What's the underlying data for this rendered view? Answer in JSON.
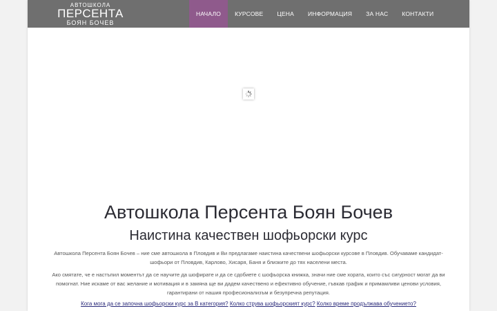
{
  "header": {
    "logo": {
      "line1": "АВТОШКОЛА",
      "line2": "ПЕРСЕНТА",
      "line3": "БОЯН БОЧЕВ"
    },
    "nav": [
      {
        "label": "НАЧАЛО",
        "active": true
      },
      {
        "label": "КУРСОВЕ",
        "active": false
      },
      {
        "label": "ЦЕНА",
        "active": false
      },
      {
        "label": "ИНФОРМАЦИЯ",
        "active": false
      },
      {
        "label": "ЗА НАС",
        "active": false
      },
      {
        "label": "КОНТАКТИ",
        "active": false
      }
    ]
  },
  "slider": {
    "loader_icon": "spinner-icon"
  },
  "main": {
    "title": "Автошкола Персента Боян Бочев",
    "subtitle": "Наистина качествен шофьорски курс",
    "paragraph1": "Автошкола Персента Боян Бочев – ние сме автошкола в Пловдив и Ви предлагаме наистина качествени шофьорски курсове в Пловдив. Обучаваме кандидат-шофьори от Пловдив, Карлово, Хисаря, Баня и близките до тях населени места.",
    "paragraph2": "Ако смятате, че е настъпил моментът да се научите да шофирате и да се сдобиете с шофьорска книжка, значи ние сме хората, които със сигурност могат да ви помогнат. Ние искаме от вас желание и мотивация и в замяна ще ви дадем качествено и ефективно обучение, гъвкав график и примамливи ценови условия, гарантирани от нашия професионализъм и безупречна репутация.",
    "links": [
      "Кога мога да се започна шофьорски курс за В категория?",
      "Колко струва шофьорският курс?",
      "Колко време продължава обучението?"
    ]
  },
  "colors": {
    "navbar": "#6f6f6f",
    "nav_active": "#8f5a8c",
    "heading": "#2b2b33",
    "link": "#2a2a7a"
  }
}
